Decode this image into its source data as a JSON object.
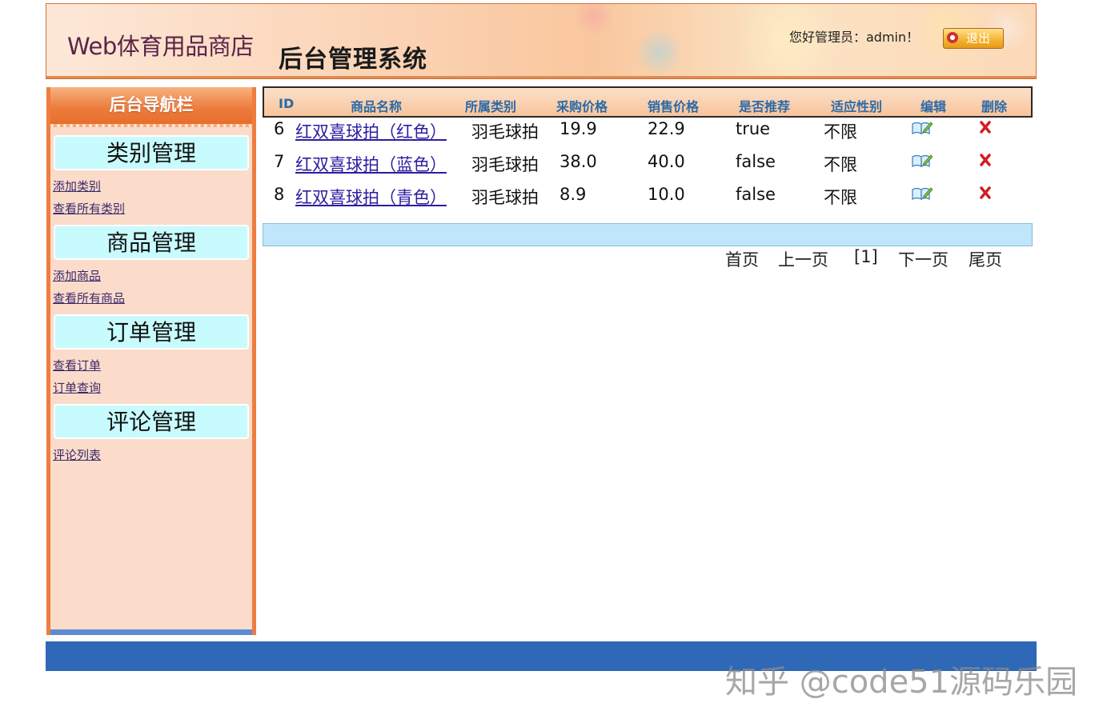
{
  "header": {
    "site_title": "Web体育用品商店",
    "system_title": "后台管理系统",
    "welcome": "您好管理员：admin！",
    "logout_label": "退出"
  },
  "sidebar": {
    "title": "后台导航栏",
    "groups": [
      {
        "label": "类别管理",
        "links": [
          "添加类别",
          "查看所有类别"
        ]
      },
      {
        "label": "商品管理",
        "links": [
          "添加商品",
          "查看所有商品"
        ]
      },
      {
        "label": "订单管理",
        "links": [
          "查看订单",
          "订单查询"
        ]
      },
      {
        "label": "评论管理",
        "links": [
          "评论列表"
        ]
      }
    ]
  },
  "table": {
    "headers": [
      "ID",
      "商品名称",
      "所属类别",
      "采购价格",
      "销售价格",
      "是否推荐",
      "适应性别",
      "编辑",
      "删除"
    ],
    "rows": [
      {
        "id": "6",
        "name": "红双喜球拍（红色）",
        "category": "羽毛球拍",
        "purchase": "19.9",
        "sale": "22.9",
        "recommend": "true",
        "gender": "不限"
      },
      {
        "id": "7",
        "name": "红双喜球拍（蓝色）",
        "category": "羽毛球拍",
        "purchase": "38.0",
        "sale": "40.0",
        "recommend": "false",
        "gender": "不限"
      },
      {
        "id": "8",
        "name": "红双喜球拍（青色）",
        "category": "羽毛球拍",
        "purchase": "8.9",
        "sale": "10.0",
        "recommend": "false",
        "gender": "不限"
      }
    ]
  },
  "pager": {
    "first": "首页",
    "prev": "上一页",
    "current": "[1]",
    "next": "下一页",
    "last": "尾页"
  },
  "watermark": "知乎 @code51源码乐园",
  "colors": {
    "sidebar_border": "#ee7d3e",
    "group_head_bg": "#c8fbfd",
    "footer_bar": "#2e68b6",
    "link": "#2a1ea0",
    "header_text": "#2b6aa6"
  }
}
